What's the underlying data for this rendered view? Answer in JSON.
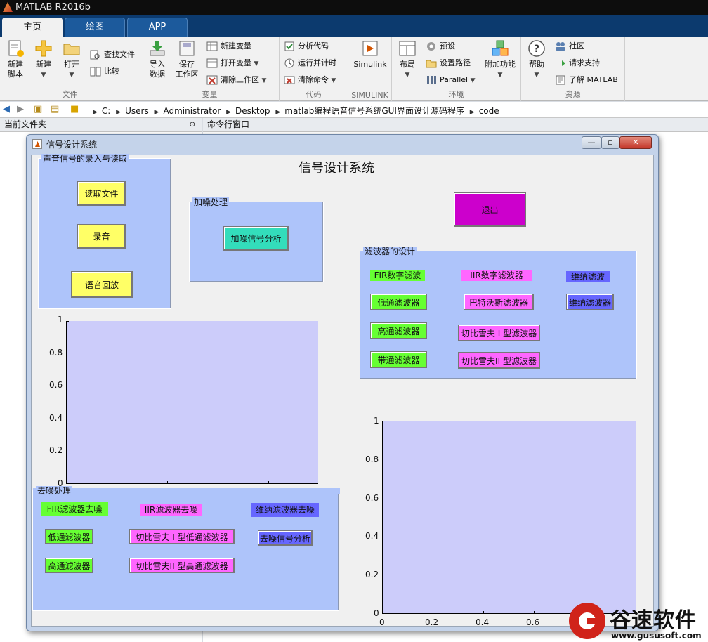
{
  "app": {
    "title": "MATLAB R2016b"
  },
  "tabs": [
    "主页",
    "绘图",
    "APP"
  ],
  "ribbon": {
    "file": {
      "label": "文件",
      "new_script": "新建\n脚本",
      "new": "新建",
      "open": "打开",
      "find_files": "查找文件",
      "compare": "比较"
    },
    "variable": {
      "label": "变量",
      "import": "导入\n数据",
      "save": "保存\n工作区",
      "new_var": "新建变量",
      "open_var": "打开变量",
      "clear_ws": "清除工作区"
    },
    "code": {
      "label": "代码",
      "analyze": "分析代码",
      "run_time": "运行并计时",
      "clear_cmd": "清除命令"
    },
    "simulink": {
      "label": "SIMULINK",
      "simulink": "Simulink"
    },
    "env": {
      "label": "环境",
      "layout": "布局",
      "prefs": "预设",
      "set_path": "设置路径",
      "parallel": "Parallel",
      "addons": "附加功能"
    },
    "resources": {
      "label": "资源",
      "help": "帮助",
      "community": "社区",
      "support": "请求支持",
      "learn": "了解 MATLAB"
    }
  },
  "address": {
    "crumbs": [
      "C:",
      "Users",
      "Administrator",
      "Desktop",
      "matlab编程语音信号系统GUI界面设计源码程序",
      "code"
    ]
  },
  "panes": {
    "current_folder": "当前文件夹",
    "command_window": "命令行窗口"
  },
  "figure": {
    "window_title": "信号设计系统",
    "main_title": "信号设计系统",
    "colors": {
      "yellow": "#ffff66",
      "magenta": "#cc00cc",
      "green": "#66ff33",
      "pink": "#ff66ff",
      "blue": "#6666ff",
      "teal": "#33ddbb"
    },
    "record_panel": {
      "title": "声音信号的录入与读取",
      "read_file": "读取文件",
      "record": "录音",
      "playback": "语音回放"
    },
    "noise_panel": {
      "title": "加噪处理",
      "analyze": "加噪信号分析"
    },
    "exit": "退出",
    "filter_panel": {
      "title": "滤波器的设计",
      "fir": "FIR数字滤波",
      "iir": "IIR数字滤波器",
      "wiener": "维纳滤波",
      "lowpass": "低通滤波器",
      "butter": "巴特沃斯滤波器",
      "wiener_btn": "维纳滤波器",
      "highpass": "高通滤波器",
      "cheby1": "切比雪夫 I 型滤波器",
      "bandpass": "带通滤波器",
      "cheby2": "切比雪夫II 型滤波器"
    },
    "denoise_panel": {
      "title": "去噪处理",
      "fir": "FIR滤波器去噪",
      "iir": "IIR滤波器去噪",
      "wiener": "维纳滤波器去噪",
      "lowpass": "低通滤波器",
      "cheby1_low": "切比雪夫 I 型低通滤波器",
      "analyze": "去噪信号分析",
      "highpass": "高通滤波器",
      "cheby2_high": "切比雪夫II 型高通滤波器"
    },
    "axes1": {
      "yticks": [
        "1",
        "0.8",
        "0.6",
        "0.4",
        "0.2",
        "0"
      ]
    },
    "axes2": {
      "yticks": [
        "1",
        "0.8",
        "0.6",
        "0.4",
        "0.2",
        "0"
      ],
      "xticks": [
        "0",
        "0.2",
        "0.4",
        "0.6"
      ]
    }
  },
  "watermark": {
    "name": "谷速软件",
    "url": "www.gususoft.com"
  }
}
